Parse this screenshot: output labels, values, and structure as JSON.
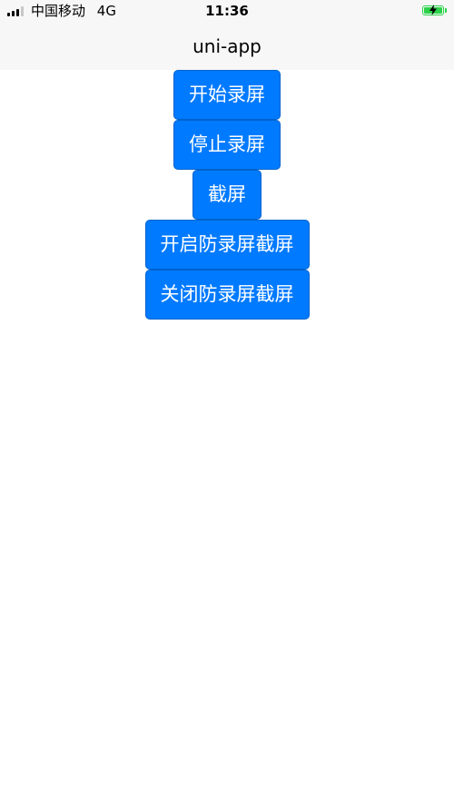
{
  "status_bar": {
    "carrier": "中国移动",
    "network": "4G",
    "time": "11:36",
    "battery_color": "#2bd24a"
  },
  "nav": {
    "title": "uni-app"
  },
  "buttons": {
    "start_recording": "开始录屏",
    "stop_recording": "停止录屏",
    "screenshot": "截屏",
    "enable_protection": "开启防录屏截屏",
    "disable_protection": "关闭防录屏截屏"
  },
  "theme": {
    "button_color": "#007aff",
    "bar_background": "#f7f7f7"
  }
}
